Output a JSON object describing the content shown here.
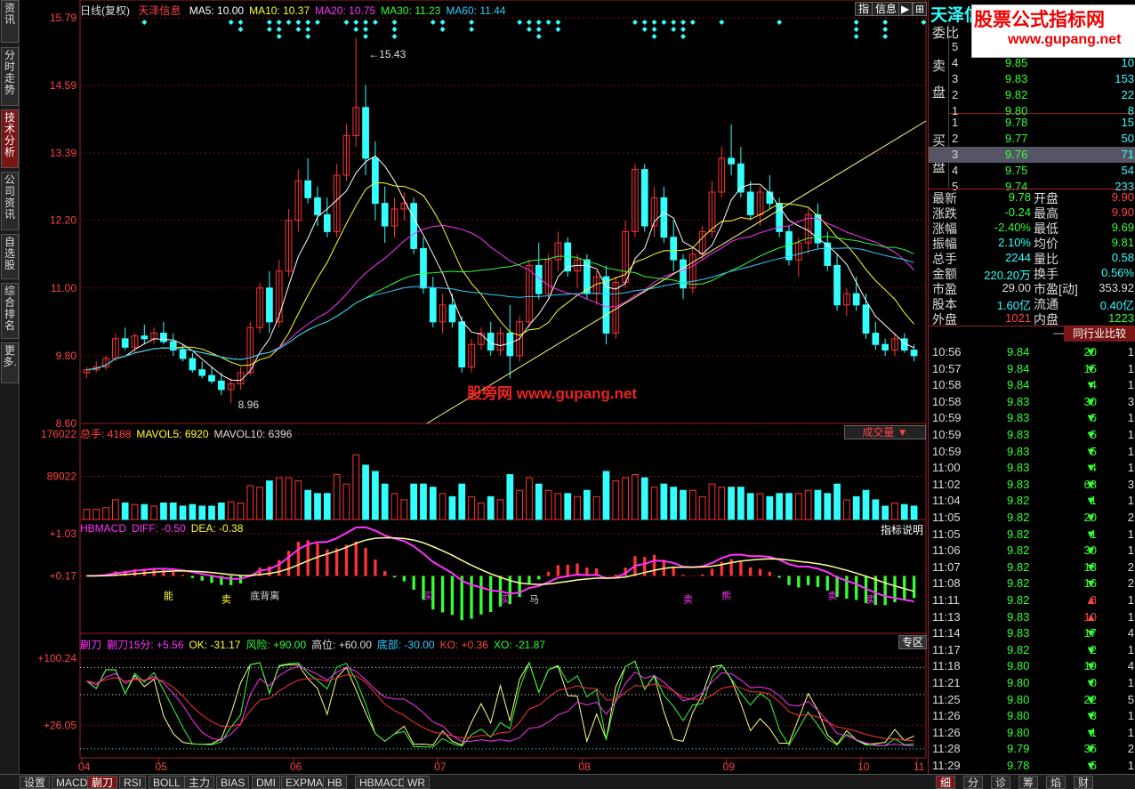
{
  "left_tabs": [
    {
      "label": "资讯",
      "active": false
    },
    {
      "label": "分时走势",
      "active": false
    },
    {
      "label": "技术分析",
      "active": true
    },
    {
      "label": "公司资讯",
      "active": false
    },
    {
      "label": "自选股",
      "active": false
    },
    {
      "label": "综合排名",
      "active": false
    },
    {
      "label": "更多.",
      "active": false
    }
  ],
  "main": {
    "period": "日线(复权)",
    "stock_name": "天泽信息",
    "ma": [
      {
        "label": "MA5:",
        "value": "10.00",
        "color": "#ffffff"
      },
      {
        "label": "MA10:",
        "value": "10.37",
        "color": "#ffff33"
      },
      {
        "label": "MA20:",
        "value": "10.75",
        "color": "#ff33ff"
      },
      {
        "label": "MA30:",
        "value": "11.23",
        "color": "#33ff33"
      },
      {
        "label": "MA60:",
        "value": "11.44",
        "color": "#33ccff"
      }
    ],
    "y_ticks": [
      "15.79",
      "14.59",
      "13.39",
      "12.20",
      "11.00",
      "9.80",
      "8.60"
    ],
    "high_label": "15.43",
    "low_label": "8.96",
    "top_buttons": {
      "zhi": "指",
      "info": "信息"
    },
    "watermark": "股旁网  www.gupang.net"
  },
  "volume": {
    "header": [
      {
        "text": "总手: 4188",
        "color": "#f44"
      },
      {
        "text": "MAVOL5: 6920",
        "color": "#ffff33"
      },
      {
        "text": "MAVOL10: 6396",
        "color": "#ddd"
      }
    ],
    "y_ticks": [
      "176022",
      "89022"
    ],
    "selector": "成交量"
  },
  "macd": {
    "header": [
      {
        "text": "HBMACD",
        "color": "#ff33ff"
      },
      {
        "text": "DIFF: -0.50",
        "color": "#ff33ff"
      },
      {
        "text": "DEA: -0.38",
        "color": "#ffff33"
      }
    ],
    "y_ticks": [
      "+1.03",
      "+0.17"
    ],
    "help": "指标说明",
    "labels": [
      "能",
      "卖",
      "底背离",
      "马",
      "买",
      "卖",
      "熊",
      "买",
      "卖",
      "卖"
    ]
  },
  "kdj": {
    "header": [
      {
        "text": "蒯刀",
        "color": "#ff33ff"
      },
      {
        "text": "蒯刀15分: +5.56",
        "color": "#ff33ff"
      },
      {
        "text": "OK: -31.17",
        "color": "#ffff33"
      },
      {
        "text": "风险: +90.00",
        "color": "#33ff33"
      },
      {
        "text": "高位: +60.00",
        "color": "#ddd"
      },
      {
        "text": "底部: -30.00",
        "color": "#33ccff"
      },
      {
        "text": "KO: +0.36",
        "color": "#f44"
      },
      {
        "text": "XO: -21.87",
        "color": "#33ff33"
      }
    ],
    "y_ticks": [
      "+100.24",
      "+26.05"
    ],
    "zone": "专区"
  },
  "x_ticks": [
    "04",
    "05",
    "06",
    "07",
    "08",
    "09",
    "10",
    "11"
  ],
  "bottom_tabs": [
    {
      "label": "设置",
      "active": false
    },
    {
      "label": "MACD",
      "active": false
    },
    {
      "label": "蒯刀",
      "active": true
    },
    {
      "label": "RSI",
      "active": false
    },
    {
      "label": "BOLL",
      "active": false
    },
    {
      "label": "主力",
      "active": false
    },
    {
      "label": "BIAS",
      "active": false
    },
    {
      "label": "DMI",
      "active": false
    },
    {
      "label": "EXPMA",
      "active": false
    },
    {
      "label": "HB",
      "active": false
    },
    {
      "label": "HBMACD",
      "active": false
    },
    {
      "label": "WR",
      "active": false
    }
  ],
  "right_bottom_tabs": [
    {
      "label": "细",
      "active": true
    },
    {
      "label": "分",
      "active": false
    },
    {
      "label": "诊",
      "active": false
    },
    {
      "label": "筹",
      "active": false
    },
    {
      "label": "焰",
      "active": false
    },
    {
      "label": "财",
      "active": false
    }
  ],
  "quote": {
    "brand": "天泽信息",
    "ad_title": "股票公式指标网",
    "ad_url": "www.gupang.net",
    "weibi_label": "委比",
    "sell_side_label": "卖盘",
    "buy_side_label": "买盘",
    "sell": [
      {
        "lvl": "5",
        "price": "",
        "vol": ""
      },
      {
        "lvl": "4",
        "price": "9.85",
        "vol": "10"
      },
      {
        "lvl": "3",
        "price": "9.83",
        "vol": "153"
      },
      {
        "lvl": "2",
        "price": "9.82",
        "vol": "22"
      },
      {
        "lvl": "1",
        "price": "9.80",
        "vol": "8"
      }
    ],
    "buy": [
      {
        "lvl": "1",
        "price": "9.78",
        "vol": "15"
      },
      {
        "lvl": "2",
        "price": "9.77",
        "vol": "50"
      },
      {
        "lvl": "3",
        "price": "9.76",
        "vol": "71"
      },
      {
        "lvl": "4",
        "price": "9.75",
        "vol": "54"
      },
      {
        "lvl": "5",
        "price": "9.74",
        "vol": "233"
      }
    ],
    "stats": [
      {
        "l1": "最新",
        "v1": "9.78",
        "c1": "#3f3",
        "l2": "开盘",
        "v2": "9.90",
        "c2": "#f44"
      },
      {
        "l1": "涨跌",
        "v1": "-0.24",
        "c1": "#3f3",
        "l2": "最高",
        "v2": "9.90",
        "c2": "#f44"
      },
      {
        "l1": "涨幅",
        "v1": "-2.40%",
        "c1": "#3f3",
        "l2": "最低",
        "v2": "9.69",
        "c2": "#3f3"
      },
      {
        "l1": "振幅",
        "v1": "2.10%",
        "c1": "#3ff",
        "l2": "均价",
        "v2": "9.81",
        "c2": "#3f3"
      },
      {
        "l1": "总手",
        "v1": "2244",
        "c1": "#3ff",
        "l2": "量比",
        "v2": "0.58",
        "c2": "#3ff"
      },
      {
        "l1": "金额",
        "v1": "220.20万",
        "c1": "#3ff",
        "l2": "换手",
        "v2": "0.56%",
        "c2": "#3ff"
      },
      {
        "l1": "市盈",
        "v1": "29.00",
        "c1": "#ddd",
        "l2": "市盈[动]",
        "v2": "353.92",
        "c2": "#ddd"
      },
      {
        "l1": "股本",
        "v1": "1.60亿",
        "c1": "#3ff",
        "l2": "流通",
        "v2": "0.40亿",
        "c2": "#3ff"
      },
      {
        "l1": "外盘",
        "v1": "1021",
        "c1": "#f44",
        "l2": "内盘",
        "v2": "1223",
        "c2": "#3f3"
      }
    ],
    "compare_button": "同行业比较",
    "ticks": [
      {
        "t": "10:56",
        "p": "9.84",
        "v": "20",
        "d": "down",
        "n": "1"
      },
      {
        "t": "10:57",
        "p": "9.84",
        "v": "15",
        "d": "down",
        "n": "1"
      },
      {
        "t": "10:58",
        "p": "9.84",
        "v": "4",
        "d": "down",
        "n": "1"
      },
      {
        "t": "10:58",
        "p": "9.83",
        "v": "30",
        "d": "down",
        "n": "3"
      },
      {
        "t": "10:59",
        "p": "9.83",
        "v": "6",
        "d": "down",
        "n": "1"
      },
      {
        "t": "10:59",
        "p": "9.83",
        "v": "5",
        "d": "down",
        "n": "1"
      },
      {
        "t": "10:59",
        "p": "9.83",
        "v": "5",
        "d": "down",
        "n": "1"
      },
      {
        "t": "11:00",
        "p": "9.83",
        "v": "4",
        "d": "down",
        "n": "1"
      },
      {
        "t": "11:02",
        "p": "9.83",
        "v": "68",
        "d": "down",
        "n": "3"
      },
      {
        "t": "11:04",
        "p": "9.82",
        "v": "1",
        "d": "down",
        "n": "1"
      },
      {
        "t": "11:05",
        "p": "9.82",
        "v": "20",
        "d": "down",
        "n": "2"
      },
      {
        "t": "11:05",
        "p": "9.82",
        "v": "1",
        "d": "down",
        "n": "1"
      },
      {
        "t": "11:06",
        "p": "9.82",
        "v": "30",
        "d": "down",
        "n": "1"
      },
      {
        "t": "11:07",
        "p": "9.82",
        "v": "13",
        "d": "down",
        "n": "2"
      },
      {
        "t": "11:08",
        "p": "9.82",
        "v": "16",
        "d": "down",
        "n": "2"
      },
      {
        "t": "11:11",
        "p": "9.82",
        "v": "8",
        "d": "up",
        "n": "1"
      },
      {
        "t": "11:13",
        "p": "9.83",
        "v": "10",
        "d": "up",
        "n": "1"
      },
      {
        "t": "11:14",
        "p": "9.83",
        "v": "17",
        "d": "down",
        "n": "4"
      },
      {
        "t": "11:17",
        "p": "9.82",
        "v": "2",
        "d": "down",
        "n": "1"
      },
      {
        "t": "11:18",
        "p": "9.80",
        "v": "19",
        "d": "down",
        "n": "4"
      },
      {
        "t": "11:21",
        "p": "9.80",
        "v": "0",
        "d": "down",
        "n": "1"
      },
      {
        "t": "11:25",
        "p": "9.80",
        "v": "22",
        "d": "down",
        "n": "5"
      },
      {
        "t": "11:26",
        "p": "9.80",
        "v": "3",
        "d": "down",
        "n": "1"
      },
      {
        "t": "11:26",
        "p": "9.80",
        "v": "1",
        "d": "down",
        "n": "1"
      },
      {
        "t": "11:28",
        "p": "9.79",
        "v": "35",
        "d": "down",
        "n": "2"
      },
      {
        "t": "11:29",
        "p": "9.78",
        "v": "5",
        "d": "down",
        "n": "1"
      }
    ]
  },
  "colors": {
    "up": "#ff3333",
    "down": "#33ffff",
    "grid": "#8a1a1a",
    "accent": "#7a1515"
  },
  "chart_data": {
    "type": "candlestick",
    "title": "日线(复权)",
    "x_ticks": [
      "04",
      "05",
      "06",
      "07",
      "08",
      "09",
      "10",
      "11"
    ],
    "ylim": [
      8.6,
      15.79
    ],
    "candles": [
      [
        9.5,
        9.6,
        9.4,
        9.55
      ],
      [
        9.55,
        9.7,
        9.5,
        9.6
      ],
      [
        9.6,
        9.8,
        9.55,
        9.75
      ],
      [
        9.75,
        10.2,
        9.7,
        10.1
      ],
      [
        10.1,
        10.3,
        9.9,
        9.95
      ],
      [
        9.95,
        10.2,
        9.85,
        10.15
      ],
      [
        10.15,
        10.35,
        10.0,
        10.1
      ],
      [
        10.1,
        10.3,
        10.0,
        10.2
      ],
      [
        10.2,
        10.4,
        10.0,
        10.05
      ],
      [
        10.05,
        10.2,
        9.8,
        9.9
      ],
      [
        9.9,
        10.0,
        9.7,
        9.75
      ],
      [
        9.75,
        9.85,
        9.5,
        9.55
      ],
      [
        9.55,
        9.7,
        9.4,
        9.45
      ],
      [
        9.45,
        9.6,
        9.3,
        9.35
      ],
      [
        9.35,
        9.5,
        9.1,
        9.2
      ],
      [
        9.2,
        9.4,
        8.96,
        9.3
      ],
      [
        9.3,
        9.6,
        9.2,
        9.5
      ],
      [
        9.5,
        10.4,
        9.45,
        10.3
      ],
      [
        10.3,
        11.1,
        10.2,
        11.0
      ],
      [
        11.0,
        11.3,
        10.2,
        10.4
      ],
      [
        10.4,
        11.5,
        10.3,
        11.3
      ],
      [
        11.3,
        12.4,
        11.2,
        12.2
      ],
      [
        12.2,
        13.1,
        12.0,
        12.9
      ],
      [
        12.9,
        13.3,
        12.5,
        12.6
      ],
      [
        12.6,
        12.8,
        12.1,
        12.3
      ],
      [
        12.3,
        12.6,
        11.9,
        12.0
      ],
      [
        12.0,
        13.2,
        11.9,
        13.0
      ],
      [
        13.0,
        13.9,
        12.9,
        13.7
      ],
      [
        13.7,
        15.43,
        13.5,
        14.2
      ],
      [
        14.2,
        14.6,
        13.0,
        13.3
      ],
      [
        13.3,
        13.6,
        12.2,
        12.5
      ],
      [
        12.5,
        12.8,
        11.8,
        12.1
      ],
      [
        12.1,
        12.6,
        11.9,
        12.4
      ],
      [
        12.4,
        12.7,
        12.2,
        12.5
      ],
      [
        12.5,
        12.6,
        11.6,
        11.7
      ],
      [
        11.7,
        11.9,
        10.9,
        11.0
      ],
      [
        11.0,
        11.2,
        10.3,
        10.4
      ],
      [
        10.4,
        10.9,
        10.2,
        10.7
      ],
      [
        10.7,
        10.9,
        10.3,
        10.4
      ],
      [
        10.4,
        10.5,
        9.5,
        9.6
      ],
      [
        9.6,
        10.1,
        9.5,
        10.0
      ],
      [
        10.0,
        10.3,
        9.9,
        10.2
      ],
      [
        10.2,
        10.4,
        9.8,
        9.9
      ],
      [
        9.9,
        10.3,
        9.8,
        10.2
      ],
      [
        10.2,
        10.7,
        9.4,
        9.8
      ],
      [
        9.8,
        10.5,
        9.7,
        10.4
      ],
      [
        10.4,
        11.5,
        10.3,
        11.4
      ],
      [
        11.4,
        11.8,
        10.8,
        10.9
      ],
      [
        10.9,
        11.6,
        10.8,
        11.5
      ],
      [
        11.5,
        12.0,
        11.3,
        11.8
      ],
      [
        11.8,
        11.9,
        11.2,
        11.3
      ],
      [
        11.3,
        11.6,
        11.0,
        11.5
      ],
      [
        11.5,
        11.6,
        10.8,
        10.9
      ],
      [
        10.9,
        11.3,
        10.7,
        11.2
      ],
      [
        11.2,
        11.4,
        10.0,
        10.2
      ],
      [
        10.2,
        11.2,
        10.1,
        11.1
      ],
      [
        11.1,
        12.2,
        11.0,
        12.0
      ],
      [
        12.0,
        13.2,
        11.9,
        13.1
      ],
      [
        13.1,
        13.2,
        12.0,
        12.1
      ],
      [
        12.1,
        12.8,
        11.9,
        12.6
      ],
      [
        12.6,
        12.8,
        11.8,
        11.9
      ],
      [
        11.9,
        12.2,
        11.3,
        11.5
      ],
      [
        11.5,
        11.6,
        10.8,
        11.0
      ],
      [
        11.0,
        11.7,
        10.9,
        11.6
      ],
      [
        11.6,
        12.1,
        11.5,
        12.0
      ],
      [
        12.0,
        12.9,
        11.9,
        12.7
      ],
      [
        12.7,
        13.5,
        12.6,
        13.3
      ],
      [
        13.3,
        13.9,
        13.0,
        13.2
      ],
      [
        13.2,
        13.5,
        12.6,
        12.7
      ],
      [
        12.7,
        12.9,
        12.2,
        12.3
      ],
      [
        12.3,
        12.8,
        12.1,
        12.7
      ],
      [
        12.7,
        13.0,
        12.4,
        12.5
      ],
      [
        12.5,
        12.6,
        11.9,
        12.0
      ],
      [
        12.0,
        12.1,
        11.4,
        11.5
      ],
      [
        11.5,
        11.9,
        11.2,
        11.8
      ],
      [
        11.8,
        12.4,
        11.6,
        12.3
      ],
      [
        12.3,
        12.5,
        11.7,
        11.8
      ],
      [
        11.8,
        12.0,
        11.3,
        11.4
      ],
      [
        11.4,
        11.6,
        10.6,
        10.7
      ],
      [
        10.7,
        11.0,
        10.5,
        10.9
      ],
      [
        10.9,
        11.2,
        10.6,
        10.7
      ],
      [
        10.7,
        10.9,
        10.1,
        10.2
      ],
      [
        10.2,
        10.4,
        9.9,
        10.0
      ],
      [
        10.0,
        10.1,
        9.8,
        9.9
      ],
      [
        9.9,
        10.2,
        9.8,
        10.1
      ],
      [
        10.1,
        10.2,
        9.85,
        9.9
      ],
      [
        9.9,
        10.0,
        9.7,
        9.8
      ]
    ],
    "ma5_last": 10.0,
    "ma10_last": 10.37,
    "ma20_last": 10.75,
    "ma30_last": 11.23,
    "ma60_last": 11.44,
    "volume_ylim": [
      0,
      176022
    ],
    "macd_diff_last": -0.5,
    "macd_dea_last": -0.38
  }
}
